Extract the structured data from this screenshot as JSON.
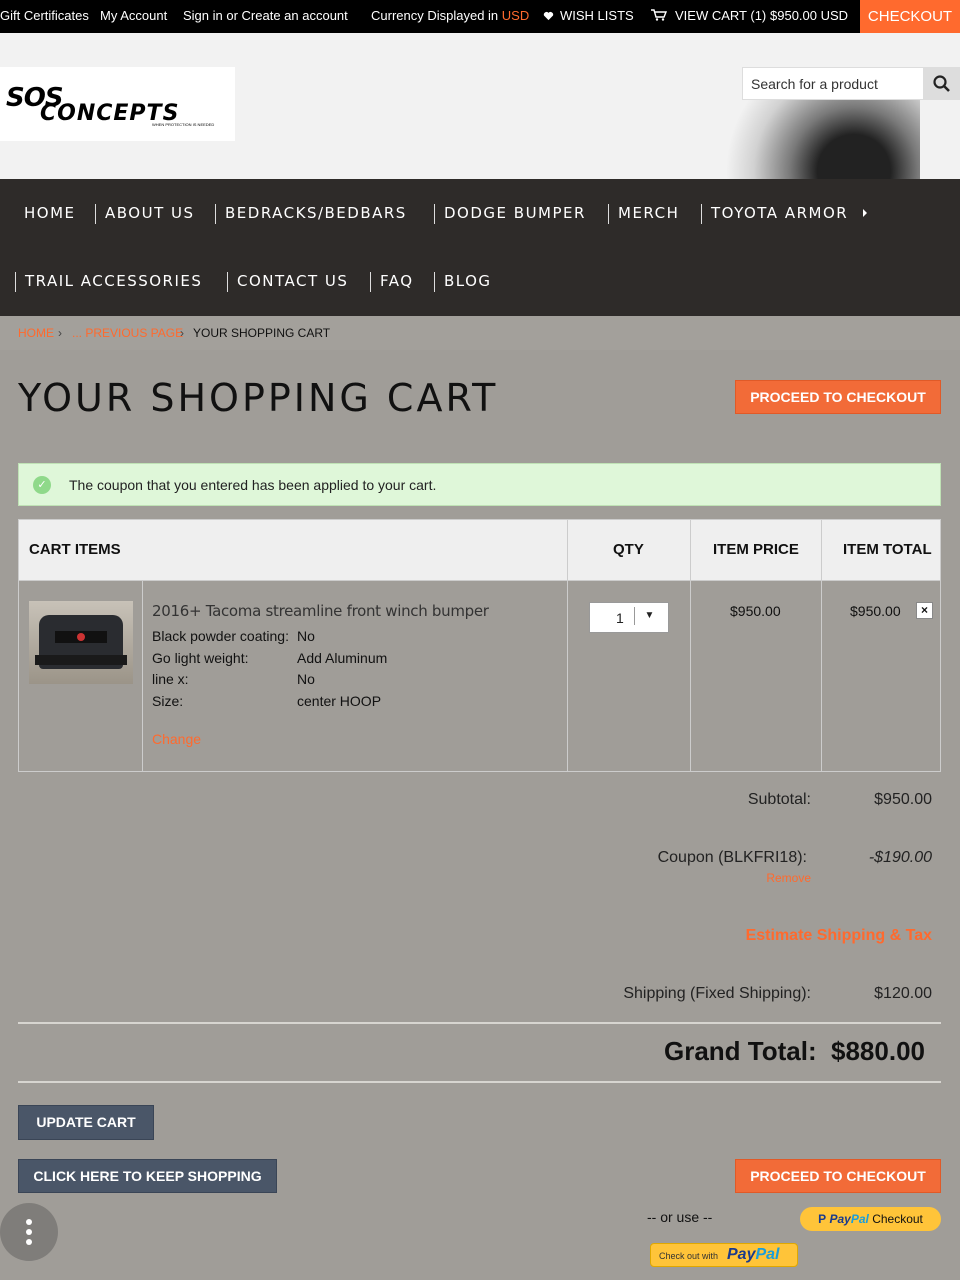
{
  "topbar": {
    "gift_certificates": "Gift Certificates",
    "my_account": "My Account",
    "sign_in": "Sign in or Create an account",
    "currency_label": "Currency Displayed in",
    "currency": "USD",
    "wish_lists": "WISH LISTS",
    "view_cart": "VIEW CART (1)",
    "cart_total": "$950.00 USD",
    "checkout": "CHECKOUT"
  },
  "header": {
    "logo_line1": "SOS",
    "logo_line2": "CONCEPTS",
    "logo_tagline": "WHEN PROTECTION IS NEEDED",
    "search_placeholder": "Search for a product"
  },
  "nav": {
    "items": [
      "HOME",
      "ABOUT US",
      "BEDRACKS/BEDBARS",
      "DODGE BUMPER",
      "MERCH",
      "TOYOTA ARMOR",
      "TRAIL ACCESSORIES",
      "CONTACT US",
      "FAQ",
      "BLOG"
    ]
  },
  "breadcrumb": {
    "home": "HOME",
    "previous": "... PREVIOUS PAGE",
    "current": "YOUR SHOPPING CART"
  },
  "page": {
    "title": "YOUR SHOPPING CART",
    "proceed_checkout": "PROCEED TO CHECKOUT",
    "coupon_message": "The coupon that you entered has been applied to your cart."
  },
  "table": {
    "headers": {
      "items": "CART ITEMS",
      "qty": "QTY",
      "price": "ITEM PRICE",
      "total": "ITEM TOTAL"
    },
    "item": {
      "name": "2016+ Tacoma streamline front winch bumper",
      "options": [
        {
          "label": "Black powder coating:",
          "value": "No"
        },
        {
          "label": "Go light weight:",
          "value": "Add Aluminum"
        },
        {
          "label": "line x:",
          "value": "No"
        },
        {
          "label": "Size:",
          "value": "center HOOP"
        }
      ],
      "change": "Change",
      "qty": "1",
      "price": "$950.00",
      "total": "$950.00"
    }
  },
  "totals": {
    "subtotal_label": "Subtotal:",
    "subtotal_value": "$950.00",
    "coupon_label": "Coupon (BLKFRI18):",
    "coupon_value": "-$190.00",
    "coupon_remove": "Remove",
    "estimate_link": "Estimate Shipping & Tax",
    "shipping_label": "Shipping (Fixed Shipping):",
    "shipping_value": "$120.00",
    "grand_label": "Grand Total:",
    "grand_value": "$880.00"
  },
  "actions": {
    "update_cart": "UPDATE CART",
    "keep_shopping": "CLICK HERE TO KEEP SHOPPING",
    "proceed_checkout": "PROCEED TO CHECKOUT",
    "or_use": "-- or use --",
    "paypal_checkout_brand1": "Pay",
    "paypal_checkout_brand2": "Pal",
    "paypal_checkout_suffix": "Checkout",
    "paypal_checkout_with": "Check out with",
    "paypal_brand1": "Pay",
    "paypal_brand2": "Pal"
  },
  "colors": {
    "accent": "#f26b38",
    "dark_button": "#4a5668",
    "background": "#a09d98",
    "nav_bg": "#2e2b29",
    "success_bg": "#dff7d9"
  }
}
